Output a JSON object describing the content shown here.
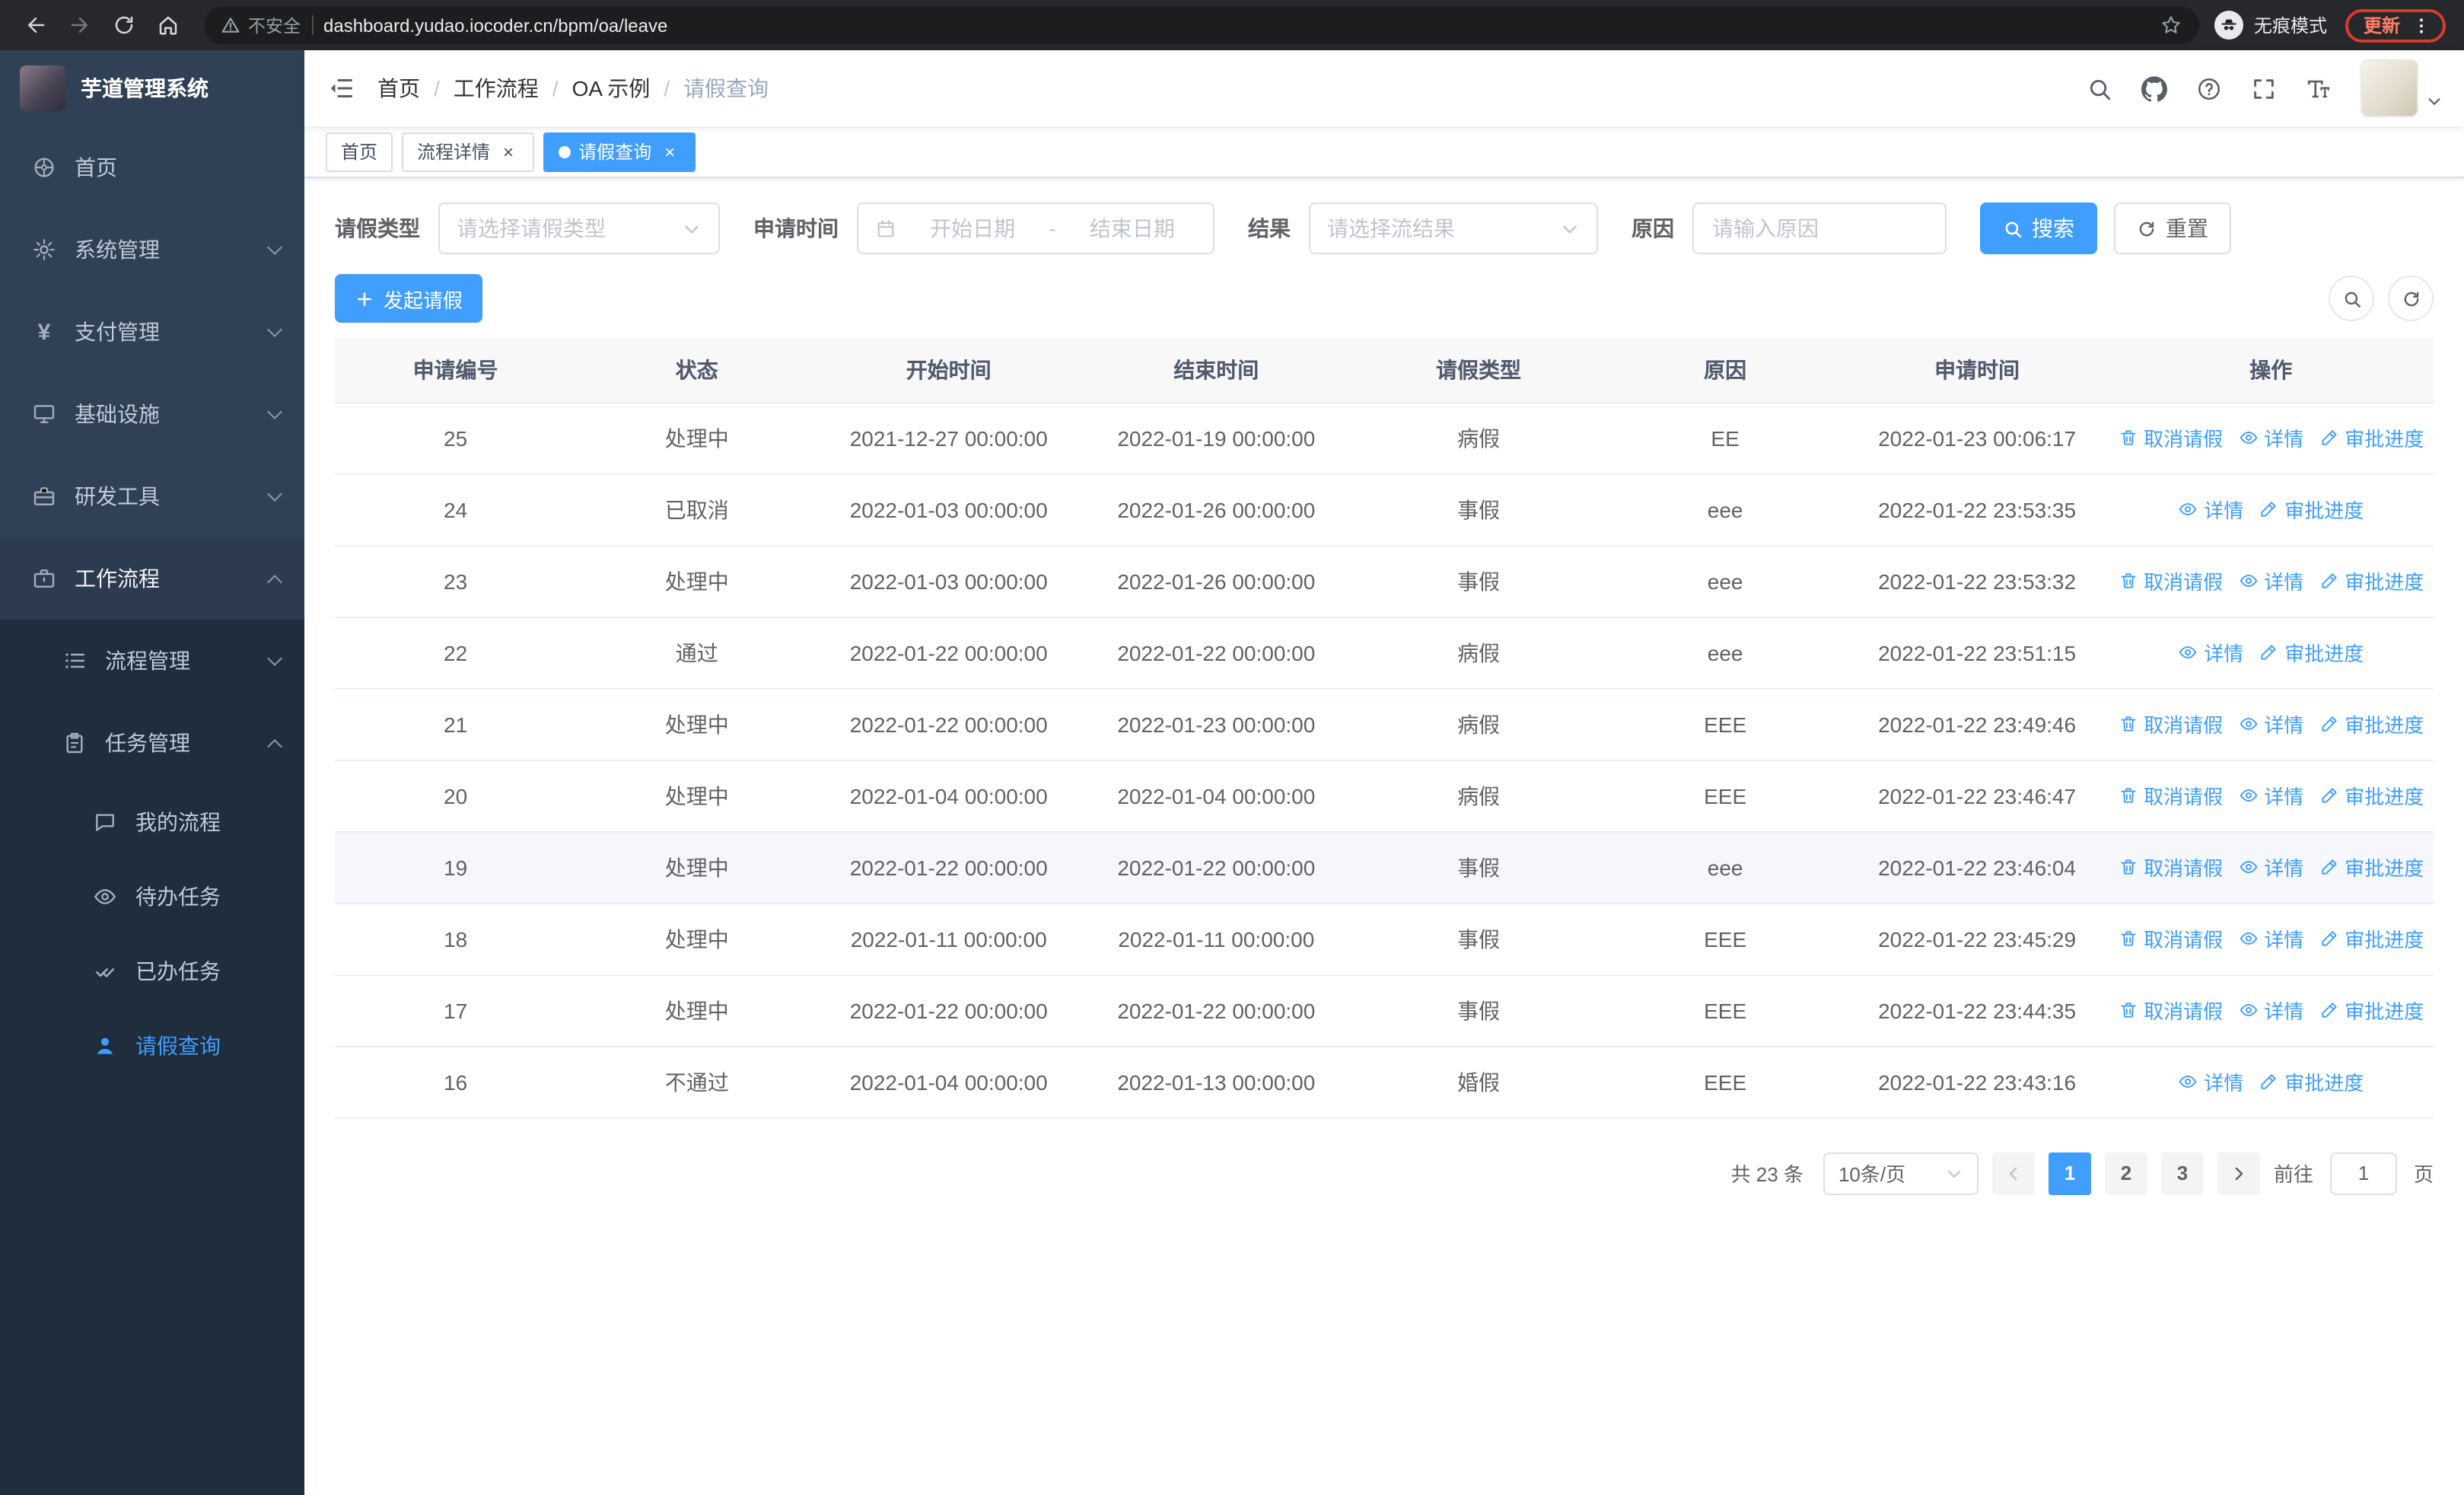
{
  "browser": {
    "security_label": "不安全",
    "url": "dashboard.yudao.iocoder.cn/bpm/oa/leave",
    "incognito_label": "无痕模式",
    "update_label": "更新"
  },
  "sidebar": {
    "app_title": "芋道管理系统",
    "menu": {
      "home": "首页",
      "system": "系统管理",
      "payment": "支付管理",
      "infra": "基础设施",
      "dev_tools": "研发工具",
      "workflow": "工作流程",
      "process_mgmt": "流程管理",
      "task_mgmt": "任务管理",
      "my_process": "我的流程",
      "todo_tasks": "待办任务",
      "done_tasks": "已办任务",
      "leave_query": "请假查询"
    }
  },
  "header": {
    "breadcrumb": [
      "首页",
      "工作流程",
      "OA 示例",
      "请假查询"
    ],
    "separator": "/"
  },
  "tabs": [
    {
      "label": "首页",
      "active": false,
      "closable": false
    },
    {
      "label": "流程详情",
      "active": false,
      "closable": true
    },
    {
      "label": "请假查询",
      "active": true,
      "closable": true
    }
  ],
  "filters": {
    "leave_type_label": "请假类型",
    "leave_type_placeholder": "请选择请假类型",
    "apply_time_label": "申请时间",
    "start_date_placeholder": "开始日期",
    "range_separator": "-",
    "end_date_placeholder": "结束日期",
    "result_label": "结果",
    "result_placeholder": "请选择流结果",
    "reason_label": "原因",
    "reason_placeholder": "请输入原因",
    "search_button": "搜索",
    "reset_button": "重置"
  },
  "toolbar": {
    "create_button": "发起请假"
  },
  "table": {
    "columns": [
      "申请编号",
      "状态",
      "开始时间",
      "结束时间",
      "请假类型",
      "原因",
      "申请时间",
      "操作"
    ],
    "actions": {
      "cancel": "取消请假",
      "detail": "详情",
      "progress": "审批进度"
    },
    "rows": [
      {
        "id": "25",
        "status": "处理中",
        "start": "2021-12-27 00:00:00",
        "end": "2022-01-19 00:00:00",
        "type": "病假",
        "reason": "EE",
        "applied": "2022-01-23 00:06:17",
        "cancelable": true
      },
      {
        "id": "24",
        "status": "已取消",
        "start": "2022-01-03 00:00:00",
        "end": "2022-01-26 00:00:00",
        "type": "事假",
        "reason": "eee",
        "applied": "2022-01-22 23:53:35",
        "cancelable": false
      },
      {
        "id": "23",
        "status": "处理中",
        "start": "2022-01-03 00:00:00",
        "end": "2022-01-26 00:00:00",
        "type": "事假",
        "reason": "eee",
        "applied": "2022-01-22 23:53:32",
        "cancelable": true
      },
      {
        "id": "22",
        "status": "通过",
        "start": "2022-01-22 00:00:00",
        "end": "2022-01-22 00:00:00",
        "type": "病假",
        "reason": "eee",
        "applied": "2022-01-22 23:51:15",
        "cancelable": false
      },
      {
        "id": "21",
        "status": "处理中",
        "start": "2022-01-22 00:00:00",
        "end": "2022-01-23 00:00:00",
        "type": "病假",
        "reason": "EEE",
        "applied": "2022-01-22 23:49:46",
        "cancelable": true
      },
      {
        "id": "20",
        "status": "处理中",
        "start": "2022-01-04 00:00:00",
        "end": "2022-01-04 00:00:00",
        "type": "病假",
        "reason": "EEE",
        "applied": "2022-01-22 23:46:47",
        "cancelable": true
      },
      {
        "id": "19",
        "status": "处理中",
        "start": "2022-01-22 00:00:00",
        "end": "2022-01-22 00:00:00",
        "type": "事假",
        "reason": "eee",
        "applied": "2022-01-22 23:46:04",
        "cancelable": true,
        "highlighted": true
      },
      {
        "id": "18",
        "status": "处理中",
        "start": "2022-01-11 00:00:00",
        "end": "2022-01-11 00:00:00",
        "type": "事假",
        "reason": "EEE",
        "applied": "2022-01-22 23:45:29",
        "cancelable": true
      },
      {
        "id": "17",
        "status": "处理中",
        "start": "2022-01-22 00:00:00",
        "end": "2022-01-22 00:00:00",
        "type": "事假",
        "reason": "EEE",
        "applied": "2022-01-22 23:44:35",
        "cancelable": true
      },
      {
        "id": "16",
        "status": "不通过",
        "start": "2022-01-04 00:00:00",
        "end": "2022-01-13 00:00:00",
        "type": "婚假",
        "reason": "EEE",
        "applied": "2022-01-22 23:43:16",
        "cancelable": false
      }
    ]
  },
  "pagination": {
    "total_label": "共 23 条",
    "page_size": "10条/页",
    "pages": [
      "1",
      "2",
      "3"
    ],
    "active_page": "1",
    "goto_label": "前往",
    "goto_value": "1",
    "goto_suffix": "页"
  },
  "colors": {
    "primary": "#409eff",
    "sidebar_bg": "#304156",
    "sidebar_sub_bg": "#1f2d3d",
    "update_pill": "#d93b2b"
  }
}
